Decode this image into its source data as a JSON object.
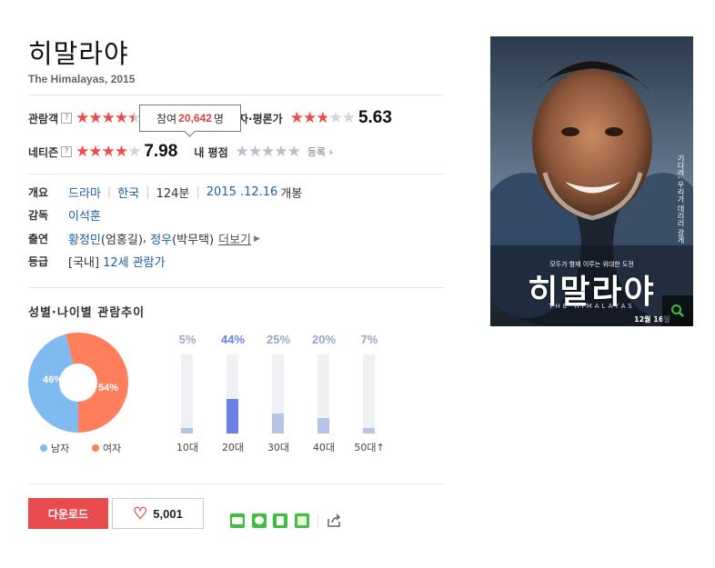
{
  "movie": {
    "title": "히말라야",
    "subtitle": "The Himalayas, 2015"
  },
  "ratings": {
    "audience_label": "관람객",
    "critic_label": "기자·평론가",
    "critic_label_visible": "자·평론가",
    "critic_score": "5.63",
    "critic_rating_fraction": 0.563,
    "netizen_label": "네티즌",
    "netizen_score": "7.98",
    "netizen_rating_fraction": 0.798,
    "audience_rating_fraction": 0.9,
    "my_rating_label": "내 평점",
    "register_label": "등록",
    "tooltip_prefix": "참여",
    "tooltip_count": "20,642",
    "tooltip_suffix": "명",
    "help_icon_text": "?"
  },
  "info": {
    "summary_label": "개요",
    "genre": "드라마",
    "country": "한국",
    "runtime": "124분",
    "release_date": "2015 .12.16",
    "release_suffix": "개봉",
    "director_label": "감독",
    "director": "이석훈",
    "cast_label": "출연",
    "cast1": "황정민",
    "cast1_role": "(엄홍길)",
    "cast2": "정우",
    "cast2_role": "(박무택)",
    "cast_more": "더보기",
    "grade_label": "등급",
    "grade_country": "[국내]",
    "grade": "12세 관람가"
  },
  "demographics": {
    "title": "성별·나이별 관람추이",
    "gender": {
      "male_label": "남자",
      "female_label": "여자",
      "male_pct": 46,
      "female_pct": 54,
      "male_text": "46%",
      "female_text": "54%",
      "male_color": "#7fbaf0",
      "female_color": "#ff7f5c"
    },
    "age": [
      {
        "label": "10대",
        "pct": 5,
        "text": "5%"
      },
      {
        "label": "20대",
        "pct": 44,
        "text": "44%",
        "highlight": true
      },
      {
        "label": "30대",
        "pct": 25,
        "text": "25%"
      },
      {
        "label": "40대",
        "pct": 20,
        "text": "20%"
      },
      {
        "label": "50대",
        "pct": 7,
        "text": "7%",
        "suffix": "↑"
      }
    ],
    "highlight_color": "#6d7fe6"
  },
  "actions": {
    "download_label": "다운로드",
    "like_count": "5,001"
  },
  "poster": {
    "title": "히말라야",
    "english": "THE HIMALAYAS",
    "tagline": "모두가 함께 이루는 위대한 도전",
    "date": "12월 16일",
    "side_text": "기다려, 우리가 데리러 갈게"
  },
  "colors": {
    "accent_red": "#e84b4e",
    "link_blue": "#1a5ea8"
  }
}
